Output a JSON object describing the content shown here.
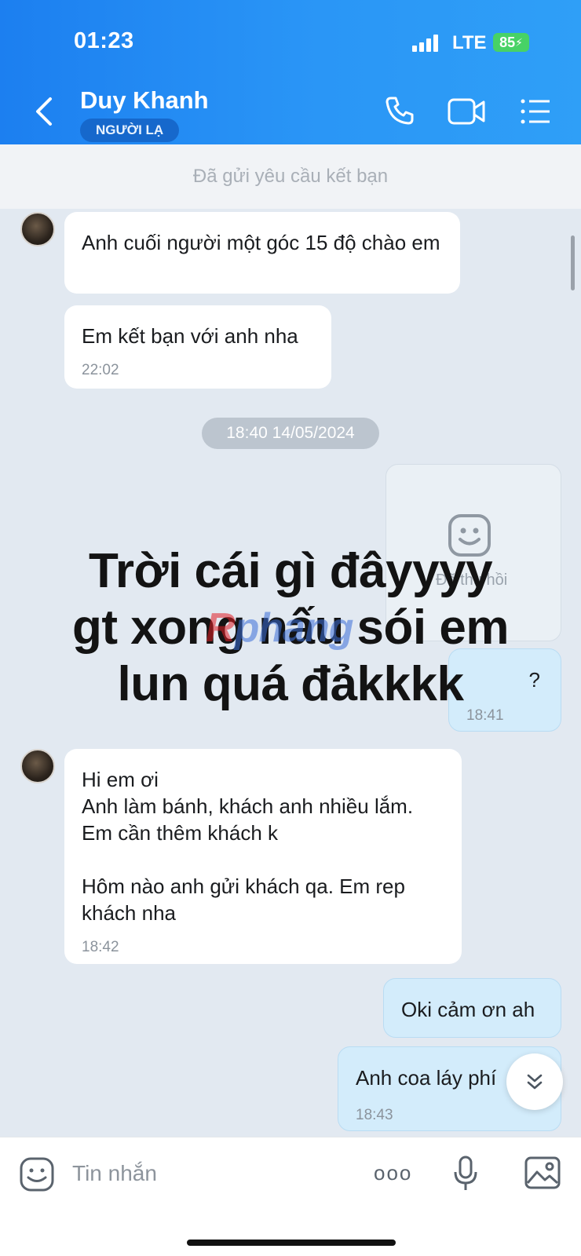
{
  "status_bar": {
    "time": "01:23",
    "network": "LTE",
    "battery": "85"
  },
  "header": {
    "contact_name": "Duy Khanh",
    "badge": "NGƯỜI LẠ"
  },
  "friend_request": {
    "text": "Đã gửi yêu cầu kết bạn"
  },
  "messages": [
    {
      "text": "Anh cuối người một góc 15 độ chào em",
      "time": ""
    },
    {
      "text": "Em kết bạn với anh nha",
      "time": "22:02"
    },
    {
      "text": "?",
      "time": "18:41"
    },
    {
      "text": " Hi em ơi\nAnh làm bánh, khách anh nhiều lắm.\nEm cần thêm khách k\n\nHôm nào anh gửi khách qa. Em rep\nkhách nha",
      "time": "18:42"
    },
    {
      "text": "Oki cảm ơn ah",
      "time": ""
    },
    {
      "text": "Anh coa láy phí",
      "time": "18:43"
    }
  ],
  "date_separator": "18:40 14/05/2024",
  "sticker": {
    "label": "Đã thu hồi"
  },
  "overlay_caption": {
    "line1": "Trời cái gì đâyyyy",
    "line2": "gt xong nấu sói em",
    "line3": "lun quá đảkkkk"
  },
  "watermark": {
    "prefix": "R",
    "rest": "phang"
  },
  "input": {
    "placeholder": "Tin nhắn",
    "more_label": "ooo"
  },
  "colors": {
    "header_blue": "#1c7ff0",
    "outgoing_bubble": "#d3ecfb",
    "chat_background": "#e2e9f1"
  }
}
